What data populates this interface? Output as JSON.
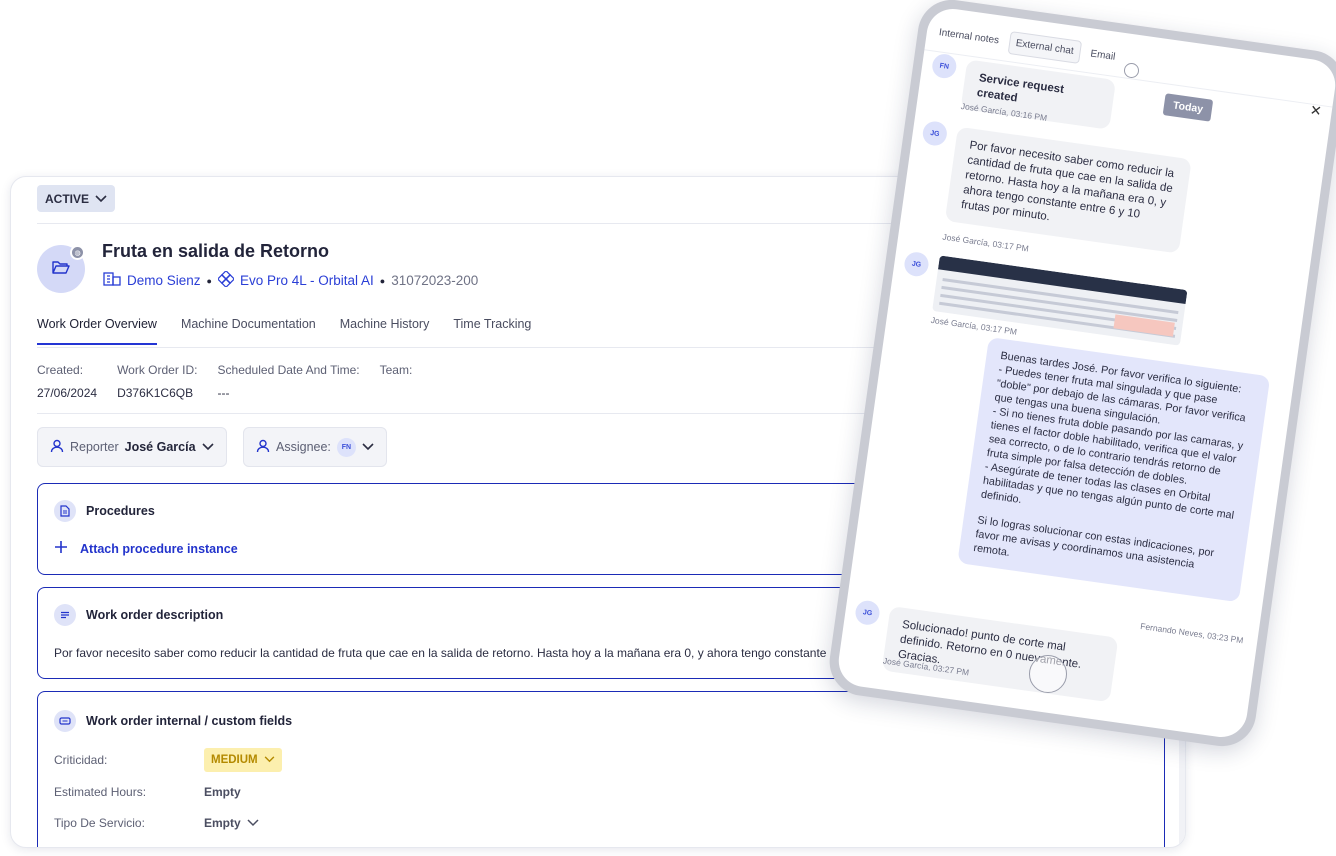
{
  "status": {
    "label": "ACTIVE"
  },
  "work_order": {
    "title": "Fruta en salida de Retorno",
    "company": "Demo Sienz",
    "machine": "Evo Pro 4L - Orbital AI",
    "code": "31072023-200"
  },
  "tabs": [
    {
      "label": "Work Order Overview",
      "active": true
    },
    {
      "label": "Machine Documentation"
    },
    {
      "label": "Machine History"
    },
    {
      "label": "Time Tracking"
    }
  ],
  "meta": {
    "created_label": "Created:",
    "created_value": "27/06/2024",
    "id_label": "Work Order ID:",
    "id_value": "D376K1C6QB",
    "scheduled_label": "Scheduled Date And Time:",
    "scheduled_value": "---",
    "team_label": "Team:"
  },
  "reporter": {
    "label": "Reporter",
    "name": "José García"
  },
  "assignee": {
    "label": "Assignee:",
    "initials": "FN"
  },
  "procedures": {
    "title": "Procedures",
    "attach_label": "Attach procedure instance"
  },
  "description": {
    "title": "Work order description",
    "text": "Por favor necesito saber como reducir la cantidad de fruta que cae en la salida de retorno. Hasta hoy a la mañana era 0, y ahora tengo constante"
  },
  "custom_fields": {
    "title": "Work order internal / custom fields",
    "rows": [
      {
        "label": "Criticidad:",
        "value": "MEDIUM"
      },
      {
        "label": "Estimated Hours:",
        "value": "Empty"
      },
      {
        "label": "Tipo De Servicio:",
        "value": "Empty"
      }
    ]
  },
  "phone": {
    "tabs": [
      "Internal notes",
      "External chat",
      "Email"
    ],
    "today": "Today",
    "messages": [
      {
        "initials": "FN",
        "text": "Service request created",
        "stamp": "José García, 03:16 PM"
      },
      {
        "initials": "JG",
        "text": "Por favor necesito saber como reducir la cantidad de fruta que cae en la salida de retorno. Hasta hoy a la mañana era 0, y ahora tengo constante entre 6 y 10 frutas por minuto.",
        "stamp": "José García, 03:17 PM"
      },
      {
        "initials": "JG",
        "stamp": "José García, 03:17 PM"
      },
      {
        "text_lines": [
          "Buenas tardes José. Por favor verifica lo siguiente:",
          "- Puedes tener fruta mal singulada y que pase \"doble\" por debajo de las cámaras. Por favor verifica que tengas una buena singulación.",
          "- Si no tienes fruta doble pasando por las camaras, y tienes el factor doble habilitado, verifica que el valor sea correcto, o de lo contrario tendrás retorno de fruta simple por falsa detección de dobles.",
          "- Asegúrate de tener todas las clases en Orbital habilitadas y que no tengas algún punto de corte mal definido.",
          "",
          "Si lo logras solucionar con estas indicaciones, por favor me avisas y coordinamos una asistencia remota."
        ],
        "stamp": "Fernando Neves, 03:23 PM"
      },
      {
        "initials": "JG",
        "text": "Solucionado! punto de corte mal definido. Retorno en 0 nuevamente. Gracias.",
        "stamp": "José García, 03:27 PM"
      }
    ]
  },
  "colors": {
    "accent": "#2334cc",
    "avatar_bg": "#d4d9f7",
    "medium_bg": "#fcefae"
  }
}
